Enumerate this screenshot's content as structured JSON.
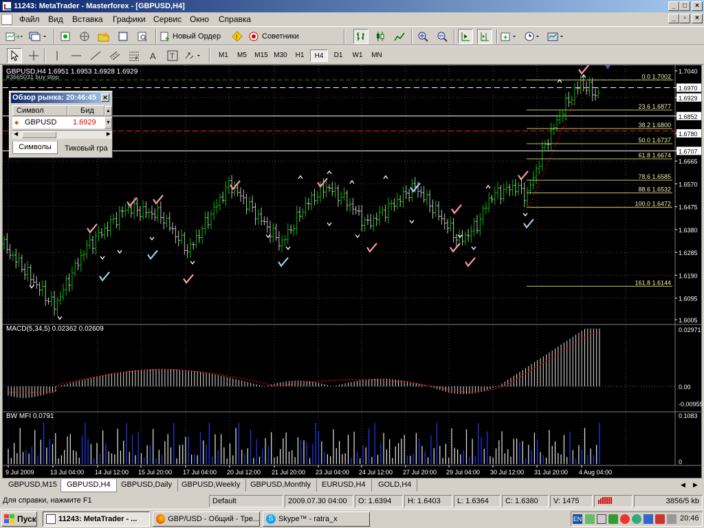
{
  "window": {
    "title": "11243: MetaTrader - Masterforex - [GBPUSD,H4]",
    "controls": [
      "_",
      "□",
      "×"
    ],
    "mdi_controls": [
      "_",
      "▫",
      "×"
    ]
  },
  "menu": [
    "Файл",
    "Вид",
    "Вставка",
    "Графики",
    "Сервис",
    "Окно",
    "Справка"
  ],
  "toolbar1": {
    "new_order": "Новый Ордер",
    "advisors": "Советники"
  },
  "timeframes": [
    "M1",
    "M5",
    "M15",
    "M30",
    "H1",
    "H4",
    "D1",
    "W1",
    "MN"
  ],
  "active_timeframe": "H4",
  "chart": {
    "header": "GBPUSD,H4  1.6951 1.6953 1.6928 1.6929",
    "overlay_label": "#3665031 buy stop",
    "price_axis": [
      "1.7040",
      "1.6970",
      "1.6929",
      "1.6852",
      "1.6780",
      "1.6707",
      "1.6665",
      "1.6570",
      "1.6475",
      "1.6380",
      "1.6285",
      "1.6190",
      "1.6095",
      "1.6005"
    ],
    "fib_levels": [
      {
        "label": "0.0  1.7002",
        "value": 1.7002
      },
      {
        "label": "23.6  1.6877",
        "value": 1.6877
      },
      {
        "label": "38.2  1.6800",
        "value": 1.68
      },
      {
        "label": "50.0  1.6737",
        "value": 1.6737
      },
      {
        "label": "61.8  1.6674",
        "value": 1.6674
      },
      {
        "label": "78.6  1.6585",
        "value": 1.6585
      },
      {
        "label": "88.6  1.6532",
        "value": 1.6532
      },
      {
        "label": "100.0  1.6472",
        "value": 1.6472
      },
      {
        "label": "161.8  1.6144",
        "value": 1.6144
      }
    ],
    "macd": {
      "label": "MACD(5,34,5) 0.02362 0.02609",
      "axis": [
        "0.02971",
        "0.00",
        "-0.00955"
      ]
    },
    "mfi": {
      "label": "BW MFI 0.0791",
      "axis": [
        "0.1083",
        "0"
      ]
    },
    "time_axis": [
      "9 Jul 2009",
      "13 Jul 04:00",
      "14 Jul 12:00",
      "15 Jul 20:00",
      "17 Jul 04:00",
      "20 Jul 12:00",
      "21 Jul 20:00",
      "23 Jul 04:00",
      "24 Jul 12:00",
      "27 Jul 20:00",
      "29 Jul 04:00",
      "30 Jul 12:00",
      "31 Jul 20:00",
      "4 Aug 04:00"
    ],
    "colors": {
      "bull": "#00c000",
      "bear": "#c0c0c0",
      "fib": "#c8c864",
      "macd_signal": "#ff0000",
      "mfi_blue": "#1e3cff",
      "grid": "#808080"
    }
  },
  "market_watch": {
    "title": "Обзор рынка: 20:46:45",
    "col_symbol": "Символ",
    "col_bid": "Бид",
    "symbol": "GBPUSD",
    "bid": "1.6929",
    "tab_symbols": "Символы",
    "tab_ticks": "Тиковый гра"
  },
  "chart_tabs": [
    "GBPUSD,M15",
    "GBPUSD,H4",
    "GBPUSD,Daily",
    "GBPUSD,Weekly",
    "GBPUSD,Monthly",
    "EURUSD,H4",
    "GOLD,H4"
  ],
  "active_chart_tab": "GBPUSD,H4",
  "statusbar": {
    "help": "Для справки, нажмите F1",
    "profile": "Default",
    "time": "2009.07.30 04:00",
    "open": "O: 1.6394",
    "high": "H: 1.6403",
    "low": "L: 1.6364",
    "close": "C: 1.6380",
    "volume": "V: 1475",
    "traffic": "3856/5 kb"
  },
  "taskbar": {
    "start": "Пуск",
    "tasks": [
      "11243: MetaTrader - ...",
      "GBP/USD - Общий - Тре...",
      "Skype™ - ratra_x"
    ],
    "lang": "EN",
    "clock": "20:46"
  }
}
